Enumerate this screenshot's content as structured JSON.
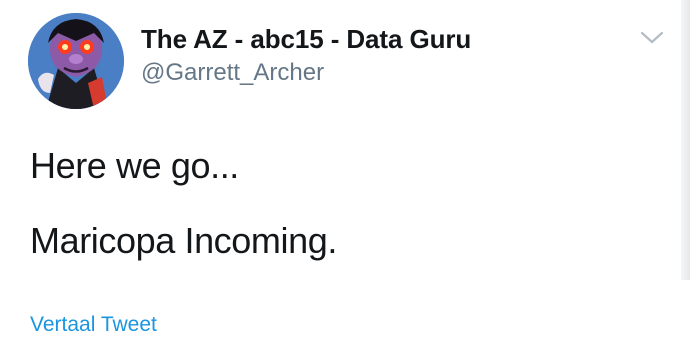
{
  "author": {
    "display_name": "The AZ - abc15 - Data Guru",
    "handle": "@Garrett_Archer",
    "avatar_icon": "count-von-count-avatar"
  },
  "tweet": {
    "lines": [
      "Here we go...",
      "Maricopa Incoming."
    ]
  },
  "actions": {
    "menu_icon": "chevron-down-icon",
    "translate_label": "Vertaal Tweet"
  },
  "colors": {
    "text": "#14171a",
    "secondary": "#657786",
    "link": "#1b95e0",
    "avatar_background": "#4a7fc6"
  }
}
